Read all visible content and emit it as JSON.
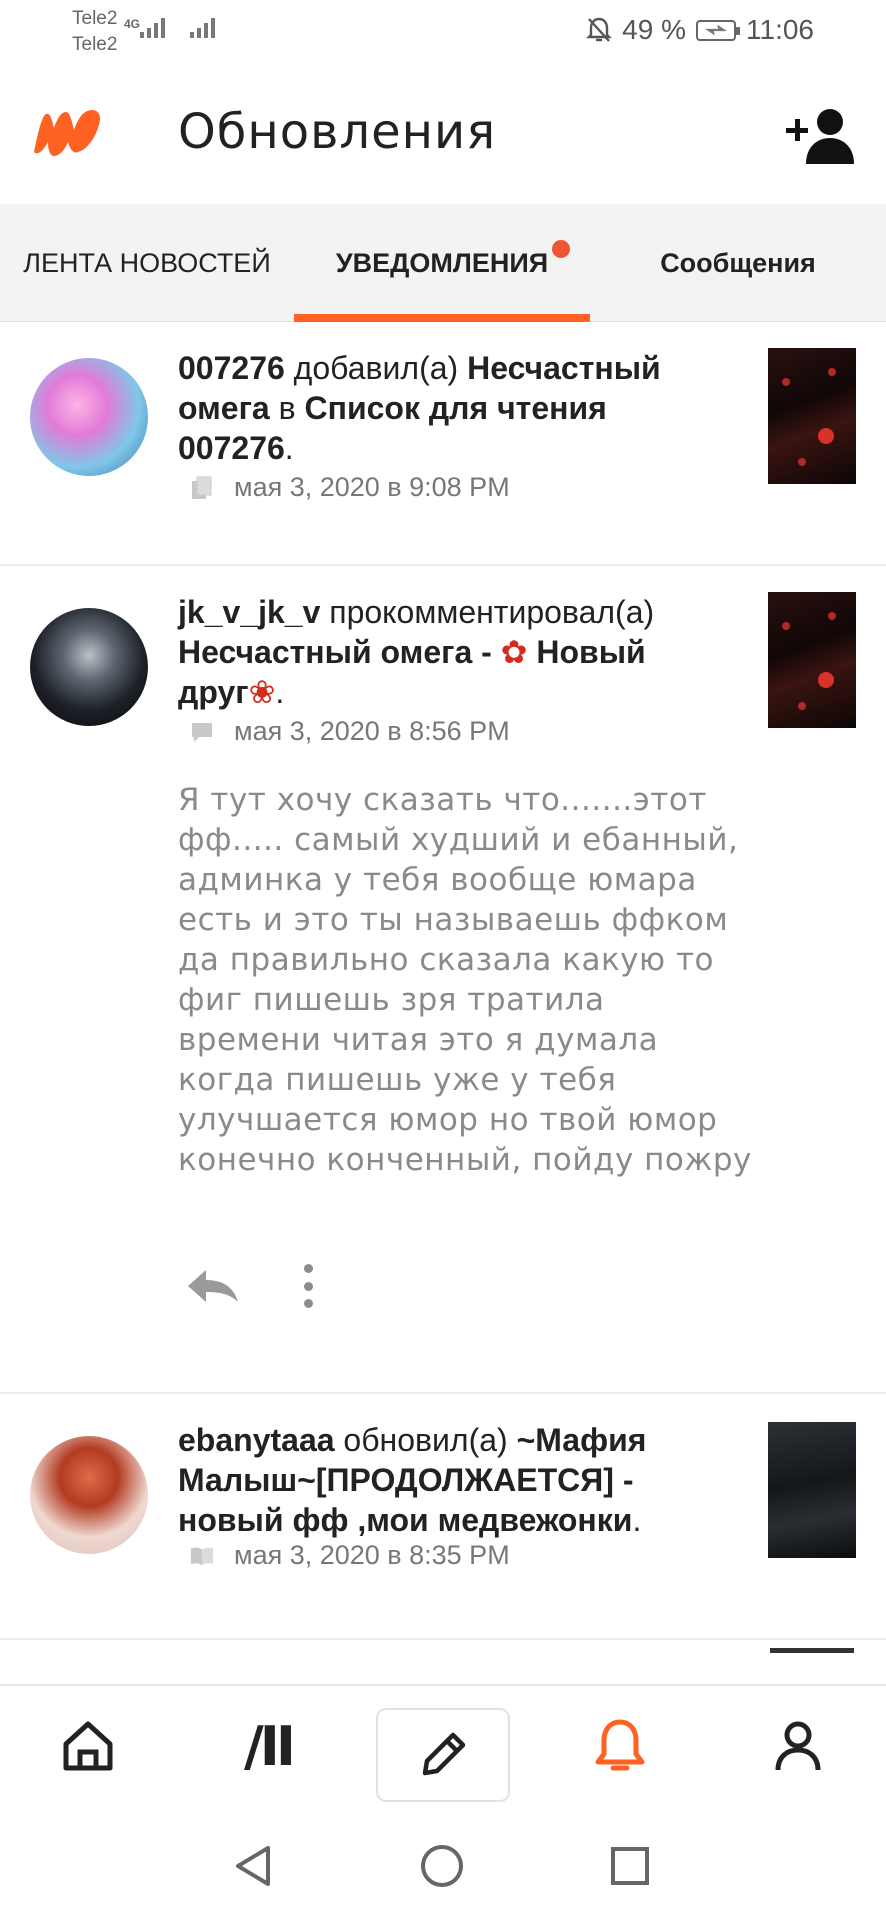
{
  "status_bar": {
    "carrier_1": "Tele2",
    "carrier_2": "Tele2",
    "network_tag": "4G",
    "battery_percent": "49 %",
    "time": "11:06",
    "icons": [
      "signal-icon",
      "mute-alarm-icon",
      "battery-charging-icon"
    ]
  },
  "header": {
    "title": "Обновления",
    "logo_icon": "wattpad-logo-icon",
    "follow_icon": "add-person-icon",
    "brand_color": "#ff6122"
  },
  "tabs": [
    {
      "label": "ЛЕНТА НОВОСТЕЙ",
      "active": false
    },
    {
      "label": "УВЕДОМЛЕНИЯ",
      "active": true,
      "has_dot": true
    },
    {
      "label": "Сообщения",
      "active": false
    }
  ],
  "feed": [
    {
      "user": "007276",
      "action": "добавил(а)",
      "target": "Несчастный омега",
      "connector": "в",
      "list_name": "Список для чтения 007276",
      "end": ".",
      "icon": "reading-list-icon",
      "timestamp": "мая 3, 2020 в 9:08 PM"
    },
    {
      "user": "jk_v_jk_v",
      "action": "прокомментировал(а)",
      "target_part1": "Несчастный омега -",
      "target_part2": "Новый друг",
      "end": ".",
      "icon": "comment-icon",
      "timestamp": "мая 3, 2020 в 8:56 PM",
      "comment": "Я тут хочу сказать что.......этот фф..... самый худший и ебанный, админка у тебя вообще юмара есть и это ты называешь ффком да правильно сказала какую то фиг пишешь зря тратила времени читая это я думала когда пишешь уже у тебя улучшается юмор но твой юмор конечно конченный, пойду пожру",
      "actions": [
        "reply-icon",
        "more-options-icon"
      ]
    },
    {
      "user": "ebanytaaa",
      "action": "обновил(а)",
      "target": "~Мафия Малыш~[ПРОДОЛЖАЕТСЯ] - новый фф ,мои медвежонки",
      "end": ".",
      "icon": "book-icon",
      "timestamp": "мая 3, 2020 в 8:35 PM"
    }
  ],
  "bottom_nav": {
    "items": [
      "home-icon",
      "browse-icon",
      "write-icon",
      "notifications-icon",
      "profile-icon"
    ],
    "browse_glyph": "/II",
    "active": "notifications-icon"
  },
  "system_nav": [
    "back-icon",
    "home-circle-icon",
    "recents-icon"
  ]
}
